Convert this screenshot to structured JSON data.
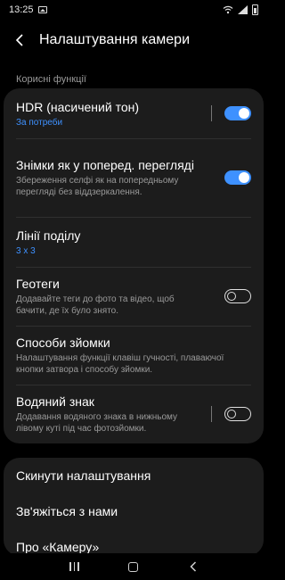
{
  "status_bar": {
    "time": "13:25"
  },
  "header": {
    "title": "Налаштування камери"
  },
  "section": {
    "label": "Корисні функції"
  },
  "settings": [
    {
      "title": "HDR (насичений тон)",
      "subtitle": "За потреби",
      "toggle": "on"
    },
    {
      "title": "Знімки як у поперед. перегляді",
      "subtitle": "Збереження селфі як на попередньому перегляді без віддзеркалення.",
      "toggle": "on"
    },
    {
      "title": "Лінії поділу",
      "subtitle": "3 x 3"
    },
    {
      "title": "Геотеги",
      "subtitle": "Додавайте теги до фото та відео, щоб бачити, де їх було знято.",
      "toggle": "off"
    },
    {
      "title": "Способи зйомки",
      "subtitle": "Налаштування функції клавіш гучності, плаваючої кнопки затвора і способу зйомки."
    },
    {
      "title": "Водяний знак",
      "subtitle": "Додавання водяного знака в нижньому лівому куті під час фотозйомки.",
      "toggle": "off"
    }
  ],
  "bottom_items": [
    {
      "label": "Скинути налаштування"
    },
    {
      "label": "Зв'яжіться з нами"
    },
    {
      "label": "Про «Камеру»"
    }
  ],
  "nav": {
    "recents": "recents-icon",
    "home": "home-icon",
    "back": "back-icon"
  },
  "colors": {
    "accent": "#3e91ff",
    "card": "#1c1c1c",
    "background": "#000000"
  }
}
